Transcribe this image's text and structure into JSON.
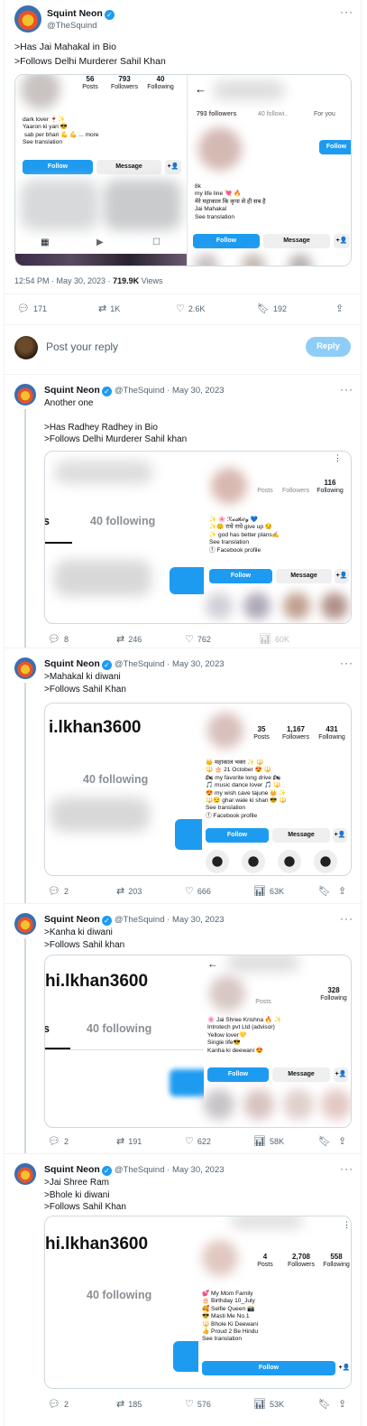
{
  "main_tweet": {
    "author": "Squint Neon",
    "handle": "@TheSquind",
    "lines": [
      ">Has Jai Mahakal in Bio",
      ">Follows Delhi Murderer Sahil Khan"
    ],
    "meta_time": "12:54 PM · May 30, 2023 · ",
    "meta_views": "719.9K",
    "meta_views_label": " Views",
    "actions": {
      "reply": "171",
      "retweet": "1K",
      "like": "2.6K",
      "bookmark": "192"
    },
    "media_left": {
      "posts_count": "56",
      "posts_label": "Posts",
      "followers_count": "793",
      "followers_label": "Followers",
      "following_count": "40",
      "following_label": "Following",
      "bio": "dark lover 🍷✨\nYaaron ki yari 😎\n sab per bhari 💪 💪 ... more\nSee translation",
      "follow": "Follow",
      "message": "Message"
    },
    "media_right": {
      "tab1": "793 followers",
      "tab2": "40 followi..",
      "tab3": "For you",
      "follow": "Follow",
      "bio": "8k\nmy life line 💘 🔥\nमेरे महाकाल कि कृपा से ही सब है\nJai Mahakal\nSee translation",
      "follow2": "Follow",
      "message": "Message"
    }
  },
  "reply_box": {
    "placeholder": "Post your reply",
    "button": "Reply"
  },
  "replies": [
    {
      "author": "Squint Neon",
      "handle": "@TheSquind",
      "date": "May 30, 2023",
      "lines": [
        "Another one",
        "",
        ">Has Radhey Radhey in Bio",
        ">Follows Delhi Murderer Sahil khan"
      ],
      "big_left": "s",
      "following_text": "40 following",
      "profile": {
        "stat3_count": "116",
        "stat1_label": "Posts",
        "stat2_label": "Followers",
        "stat3_label": "Following",
        "bio": "✨ 🌸 ℛ𝒶𝒹𝒽ℯ𝓎 💙\n✨😊 राधे राधे give up 😏\n✨ god has better plans✍\nSee translation\nⓕ Facebook profile",
        "follow": "Follow",
        "message": "Message"
      },
      "actions": {
        "reply": "8",
        "retweet": "246",
        "like": "762",
        "views": "60K"
      }
    },
    {
      "author": "Squint Neon",
      "handle": "@TheSquind",
      "date": "May 30, 2023",
      "lines": [
        ">Mahakal ki diwani",
        ">Follows Sahil Khan"
      ],
      "big_left": "i.lkhan3600",
      "following_text": "40 following",
      "profile": {
        "stat1_count": "35",
        "stat2_count": "1,167",
        "stat3_count": "431",
        "stat1_label": "Posts",
        "stat2_label": "Followers",
        "stat3_label": "Following",
        "bio": "👑 महाकाल भक्त ✨ 🔱\n🔱 🎂 21 October 😍 🔱\n🏍 my favorite long drive 🏍\n🎵 music dance lover 🎵 🔱\n😍 my wish cave tajune 👑 ✨\n🔱😏 ghar wale ki shan 😎 🔱\nSee translation\nⓕ Facebook profile",
        "follow": "Follow",
        "message": "Message"
      },
      "actions": {
        "reply": "2",
        "retweet": "203",
        "like": "666",
        "views": "63K"
      }
    },
    {
      "author": "Squint Neon",
      "handle": "@TheSquind",
      "date": "May 30, 2023",
      "lines": [
        ">Kanha ki diwani",
        ">Follows Sahil khan"
      ],
      "big_left": "hi.lkhan3600",
      "following_text": "40 following",
      "tab_left": "s",
      "profile": {
        "stat3_count": "328",
        "stat1_label": "Posts",
        "stat3_label": "Following",
        "bio": "🌸 Jai Shree Krishna 🔥 ✨\nIntrotech pvt Ltd (advisor)\nYellow lover💛\nSingle life😎\nKanha ki deewani 😍",
        "follow": "Follow",
        "message": "Message"
      },
      "actions": {
        "reply": "2",
        "retweet": "191",
        "like": "622",
        "views": "58K"
      }
    },
    {
      "author": "Squint Neon",
      "handle": "@TheSquind",
      "date": "May 30, 2023",
      "lines": [
        ">Jai Shree Ram",
        ">Bhole ki diwani",
        ">Follows Sahil Khan"
      ],
      "big_left": "hi.lkhan3600",
      "following_text": "40 following",
      "profile": {
        "stat1_count": "4",
        "stat2_count": "2,708",
        "stat3_count": "558",
        "stat1_label": "Posts",
        "stat2_label": "Followers",
        "stat3_label": "Following",
        "bio": "💕 My Mom Family\n🎂 Birthday 10_July\n🥰 Selfie Queen 📸\n😎 Masti Me No.1\n🔱 Bhole Ki Deewani\n👍 Proud 2 Be Hindu\nSee translation",
        "follow": "Follow"
      },
      "actions": {
        "reply": "2",
        "retweet": "185",
        "like": "576",
        "views": "53K"
      }
    }
  ],
  "icons": {
    "reply": "reply-icon",
    "retweet": "retweet-icon",
    "like": "heart-icon",
    "views": "views-icon",
    "bookmark": "bookmark-icon",
    "share": "share-icon",
    "more": "more-icon",
    "verified": "verified-badge-icon"
  },
  "colors": {
    "accent": "#1d9bf0",
    "text": "#0f1419",
    "muted": "#536471"
  }
}
